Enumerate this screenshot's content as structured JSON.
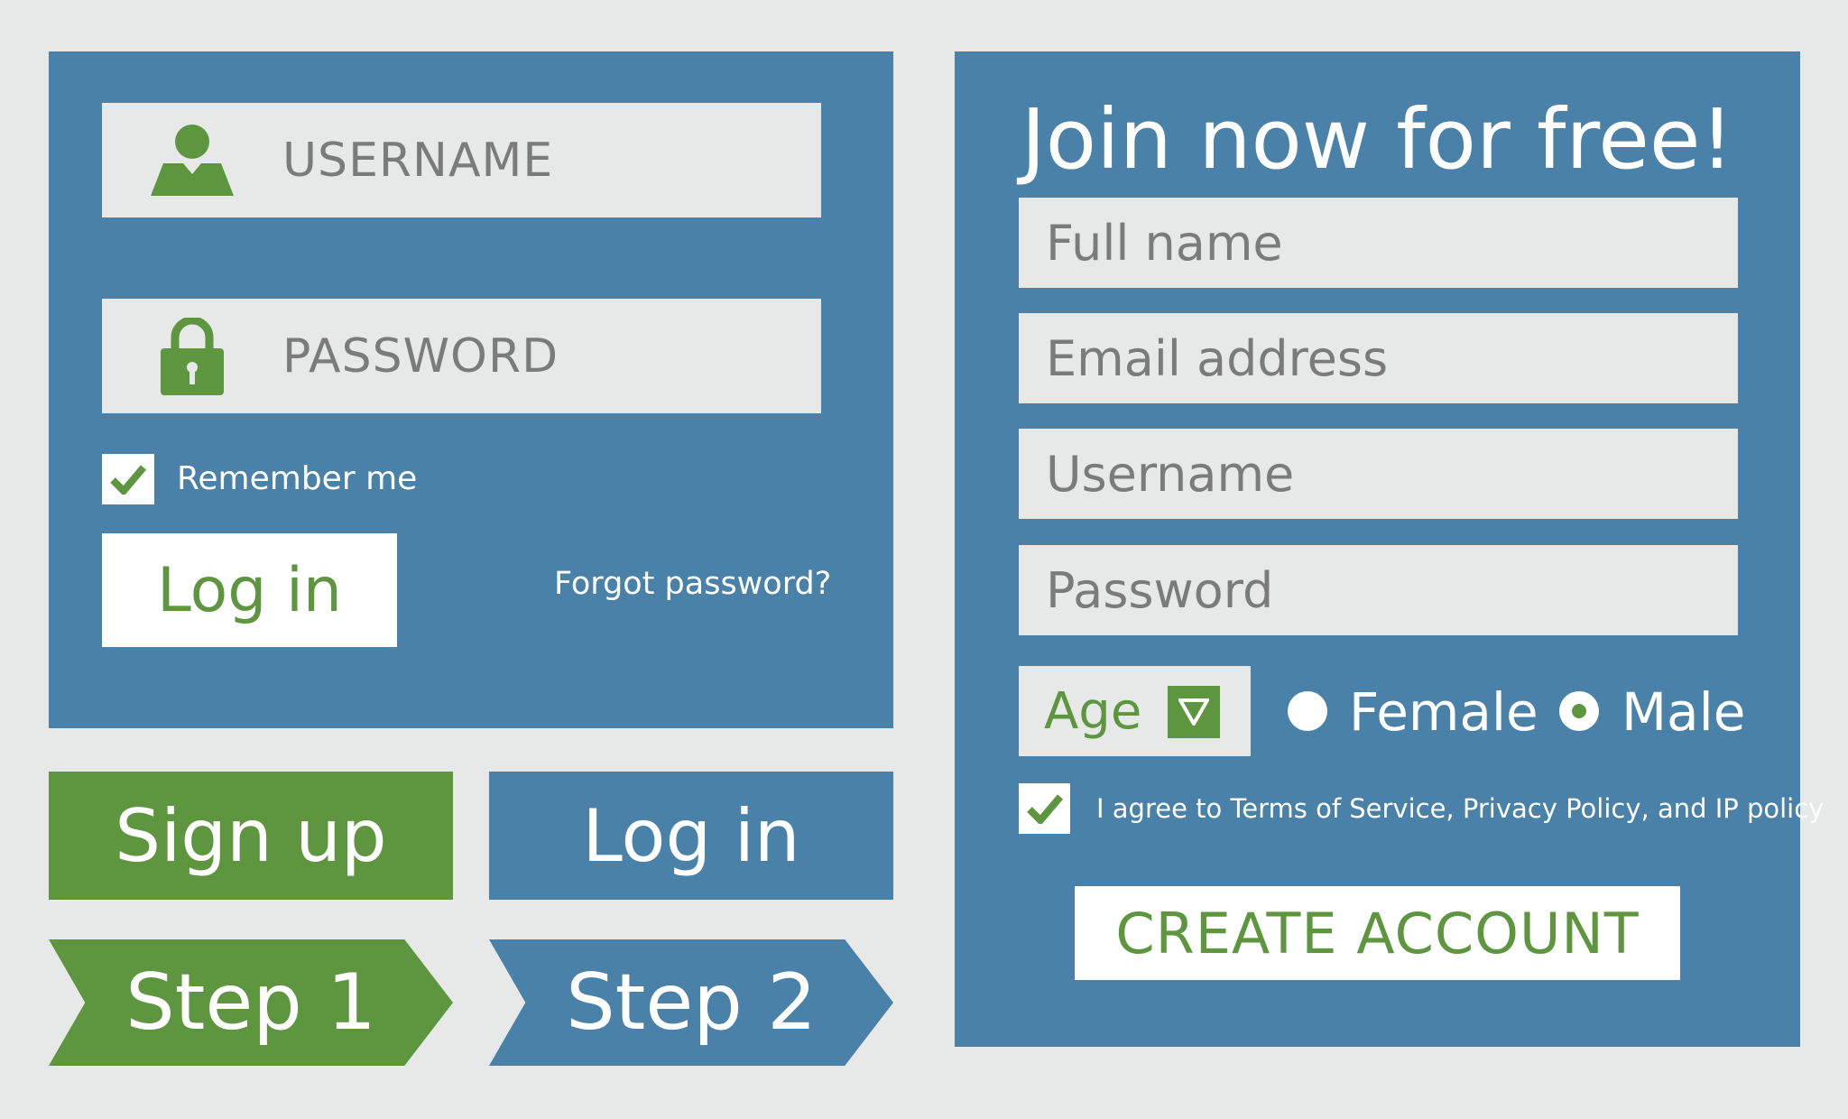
{
  "login": {
    "username_placeholder": "USERNAME",
    "password_placeholder": "PASSWORD",
    "remember_label": "Remember me",
    "login_label": "Log in",
    "forgot_label": "Forgot password?"
  },
  "buttons": {
    "signup_label": "Sign up",
    "login_label": "Log in",
    "step1_label": "Step 1",
    "step2_label": "Step 2"
  },
  "signup": {
    "title": "Join now for free!",
    "fullname_placeholder": "Full name",
    "email_placeholder": "Email address",
    "username_placeholder": "Username",
    "password_placeholder": "Password",
    "age_label": "Age",
    "female_label": "Female",
    "male_label": "Male",
    "agree_label": "I agree to Terms of Service, Privacy Policy, and IP policy",
    "create_label": "CREATE ACCOUNT",
    "selected_gender": "Male",
    "agree_checked": true
  },
  "colors": {
    "panel_blue": "#4a81a8",
    "accent_green": "#5e963f",
    "field_gray": "#e7e8e8"
  },
  "icons": [
    "user-icon",
    "lock-icon",
    "check-icon",
    "dropdown-arrow-icon"
  ]
}
